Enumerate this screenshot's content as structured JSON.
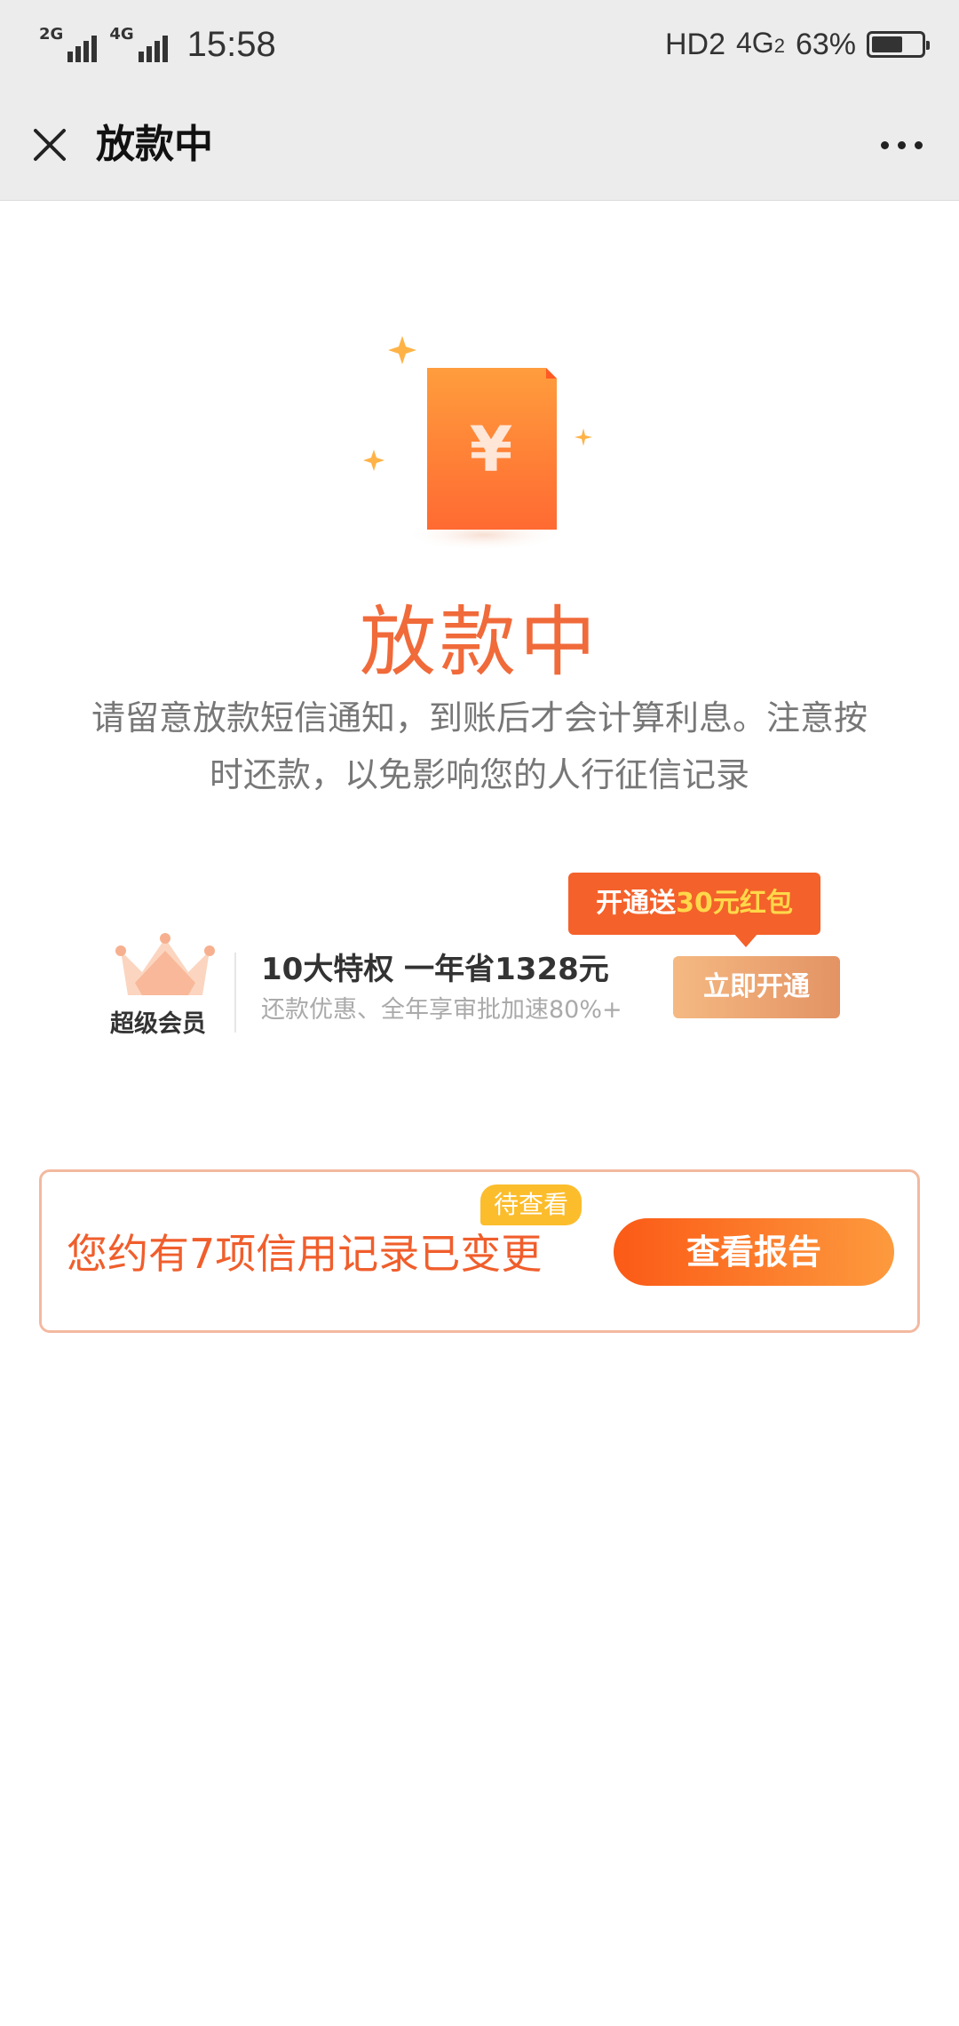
{
  "status_bar": {
    "sim1_type": "2G",
    "sim2_type": "4G",
    "time": "15:58",
    "hd_label": "HD2",
    "network_label": "4G",
    "network_sub": "2",
    "battery_percent_label": "63%",
    "battery_level": 0.63
  },
  "titlebar": {
    "title": "放款中",
    "close_icon": "close-icon",
    "more_icon": "more-dots-icon"
  },
  "status": {
    "heading": "放款中",
    "description": "请留意放款短信通知，到账后才会计算利息。注意按时还款，以免影响您的人行征信记录",
    "illustration_icon": "yuan-document-icon",
    "colors": {
      "accent": "#f06a3a"
    }
  },
  "promo": {
    "crown_icon": "crown-icon",
    "crown_label": "超级会员",
    "title": "10大特权 一年省1328元",
    "subtitle": "还款优惠、全年享审批加速80%+",
    "tag_prefix": "开通送",
    "tag_highlight": "30元红包",
    "button_label": "立即开通"
  },
  "credit": {
    "text": "您约有7项信用记录已变更",
    "badge": "待查看",
    "button_label": "查看报告"
  }
}
